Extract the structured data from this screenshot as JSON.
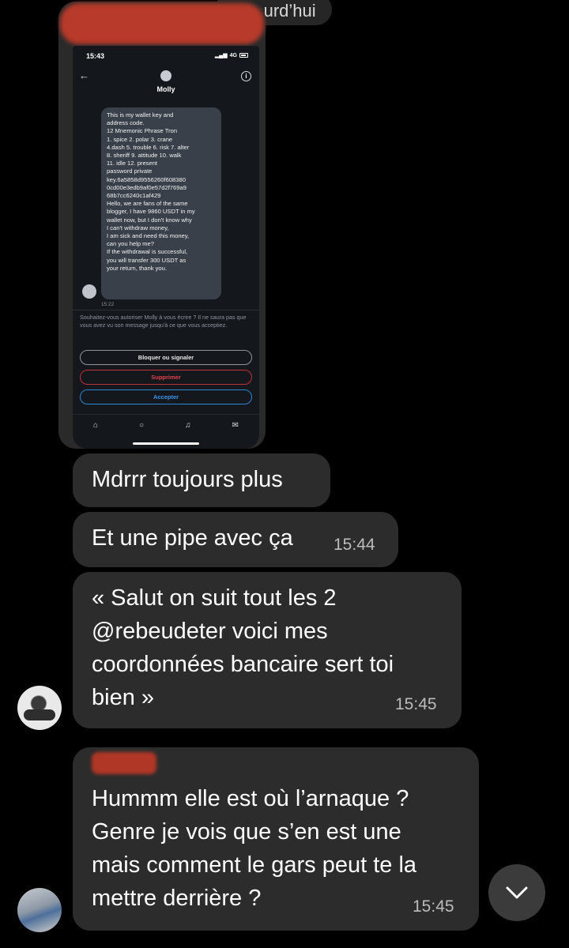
{
  "date_separator": "aujourd’hui",
  "screenshot": {
    "status_time": "15:43",
    "network": "4G",
    "contact_name": "Molly",
    "message_text": "This is my wallet key and\naddress code.\n12 Mnemonic Phrase Tron\n1. spice  2. polar  3. crane\n4.dash  5. trouble  6. risk  7. alter\n8. sheriff  9. attitude  10. walk\n11. idle  12. present\npassword private\nkey.6a5858d9556260f608380\n0cd00e3edb9af0e57d2f769a9\n68b7cc6240c1af429\nHello, we are fans of the same\nblogger, I have 9860 USDT in my\nwallet now, but I don't know why\nI can't withdraw money,\nI am sick and need this money,\ncan you help me?\nIf the withdrawal is successful,\nyou will transfer 300 USDT as\nyour return, thank you.",
    "message_time": "15:22",
    "permission_text": "Souhaitez-vous autoriser Molly à vous écrire ? Il ne saura pas que vous avez vu son message jusqu'à ce que vous acceptiez.",
    "block_label": "Bloquer ou signaler",
    "delete_label": "Supprimer",
    "accept_label": "Accepter",
    "colors": {
      "delete": "#e0424c",
      "accept": "#3b97ee"
    }
  },
  "messages": [
    {
      "text": "Mdrrr toujours plus",
      "time": ""
    },
    {
      "text": "Et une pipe avec ça",
      "time": "15:44"
    },
    {
      "text": "« Salut on suit tout les 2\n@rebeudeter voici mes\ncoordonnées bancaire sert toi\nbien »",
      "time": "15:45"
    },
    {
      "text": "Hummm elle est où l’arnaque ?\nGenre je vois que s’en est une\nmais comment le gars peut te la\nmettre derrière ?",
      "time": "15:45"
    }
  ],
  "scroll_button_icon": "chevron-down-icon",
  "colors": {
    "background": "#000000",
    "bubble": "#2c2c2c",
    "redaction": "#b83a2a"
  }
}
